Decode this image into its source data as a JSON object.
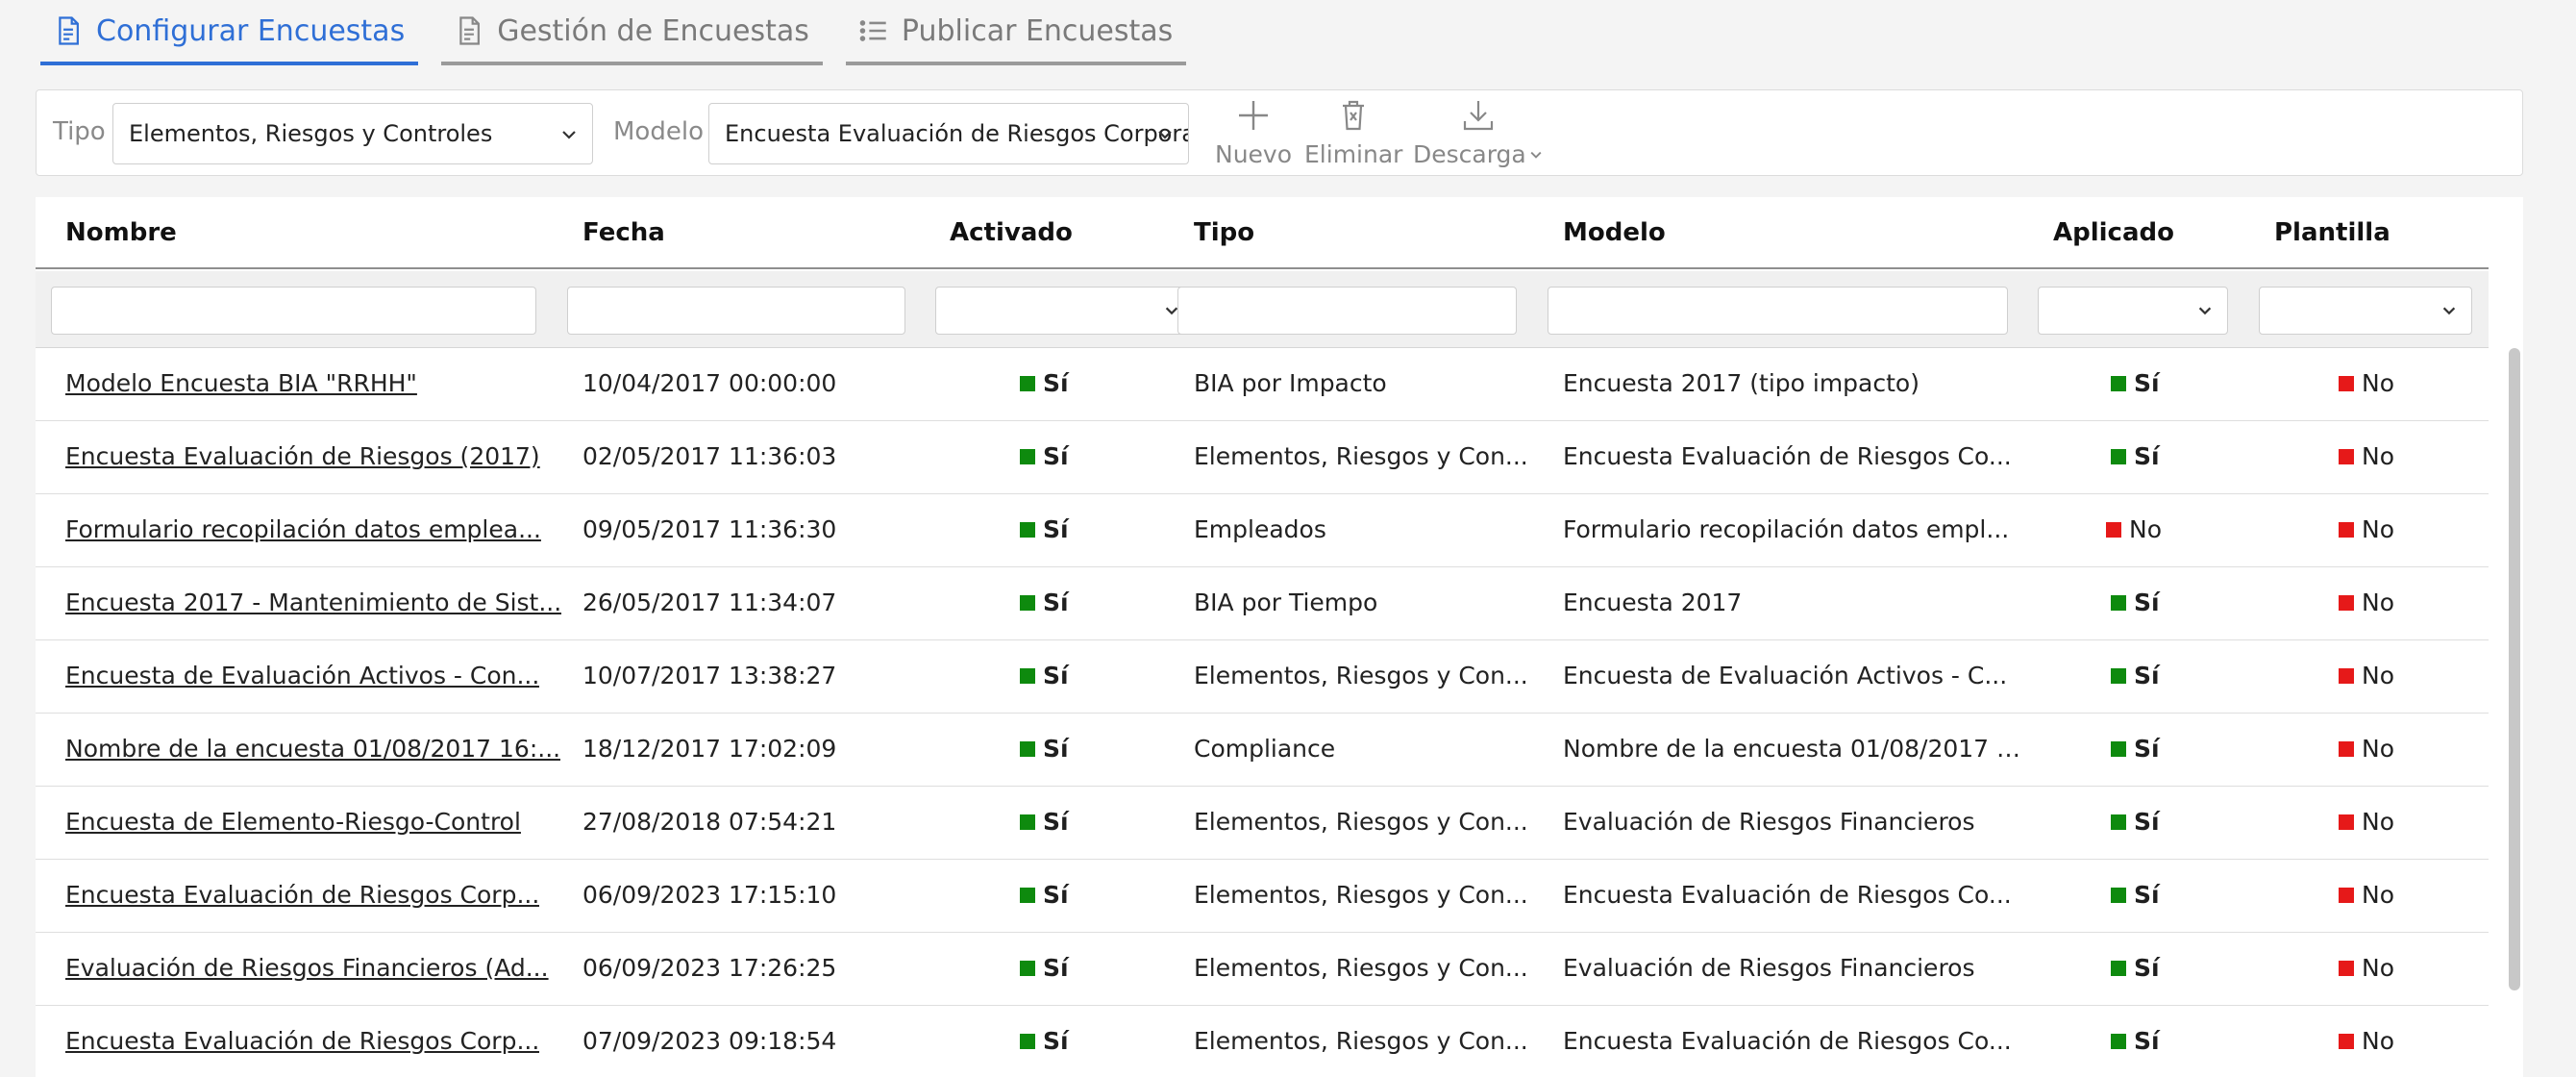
{
  "tabs": [
    {
      "label": "Configurar Encuestas",
      "active": true,
      "icon": "survey-config-icon"
    },
    {
      "label": "Gestión de Encuestas",
      "active": false,
      "icon": "survey-manage-icon"
    },
    {
      "label": "Publicar Encuestas",
      "active": false,
      "icon": "list-icon"
    }
  ],
  "toolbar": {
    "tipo_label": "Tipo",
    "tipo_value": "Elementos, Riesgos y Controles",
    "modelo_label": "Modelo",
    "modelo_value": "Encuesta Evaluación de Riesgos Corporativos",
    "nuevo_label": "Nuevo",
    "eliminar_label": "Eliminar",
    "descarga_label": "Descarga"
  },
  "columns": [
    "Nombre",
    "Fecha",
    "Activado",
    "Tipo",
    "Modelo",
    "Aplicado",
    "Plantilla"
  ],
  "rows": [
    {
      "nombre": "Modelo Encuesta BIA \"RRHH\"",
      "fecha": "10/04/2017 00:00:00",
      "activado": "Sí",
      "tipo": "BIA por Impacto",
      "modelo": "Encuesta 2017 (tipo impacto)",
      "aplicado": "Sí",
      "plantilla": "No"
    },
    {
      "nombre": "Encuesta Evaluación de Riesgos (2017)",
      "fecha": "02/05/2017 11:36:03",
      "activado": "Sí",
      "tipo": "Elementos, Riesgos y Con...",
      "modelo": "Encuesta Evaluación de Riesgos Co...",
      "aplicado": "Sí",
      "plantilla": "No"
    },
    {
      "nombre": "Formulario recopilación datos emplea...",
      "fecha": "09/05/2017 11:36:30",
      "activado": "Sí",
      "tipo": "Empleados",
      "modelo": "Formulario recopilación datos empl...",
      "aplicado": "No",
      "plantilla": "No"
    },
    {
      "nombre": "Encuesta 2017 - Mantenimiento de Sist...",
      "fecha": "26/05/2017 11:34:07",
      "activado": "Sí",
      "tipo": "BIA por Tiempo",
      "modelo": "Encuesta 2017",
      "aplicado": "Sí",
      "plantilla": "No"
    },
    {
      "nombre": "Encuesta de Evaluación Activos - Con...",
      "fecha": "10/07/2017 13:38:27",
      "activado": "Sí",
      "tipo": "Elementos, Riesgos y Con...",
      "modelo": "Encuesta de Evaluación Activos - C...",
      "aplicado": "Sí",
      "plantilla": "No"
    },
    {
      "nombre": "Nombre de la encuesta 01/08/2017 16:...",
      "fecha": "18/12/2017 17:02:09",
      "activado": "Sí",
      "tipo": "Compliance",
      "modelo": "Nombre de la encuesta 01/08/2017 1...",
      "aplicado": "Sí",
      "plantilla": "No"
    },
    {
      "nombre": "Encuesta de Elemento-Riesgo-Control",
      "fecha": "27/08/2018 07:54:21",
      "activado": "Sí",
      "tipo": "Elementos, Riesgos y Con...",
      "modelo": "Evaluación de Riesgos Financieros",
      "aplicado": "Sí",
      "plantilla": "No"
    },
    {
      "nombre": "Encuesta Evaluación de Riesgos Corp...",
      "fecha": "06/09/2023 17:15:10",
      "activado": "Sí",
      "tipo": "Elementos, Riesgos y Con...",
      "modelo": "Encuesta Evaluación de Riesgos Co...",
      "aplicado": "Sí",
      "plantilla": "No"
    },
    {
      "nombre": "Evaluación de Riesgos Financieros (Ad...",
      "fecha": "06/09/2023 17:26:25",
      "activado": "Sí",
      "tipo": "Elementos, Riesgos y Con...",
      "modelo": "Evaluación de Riesgos Financieros",
      "aplicado": "Sí",
      "plantilla": "No"
    },
    {
      "nombre": "Encuesta Evaluación de Riesgos Corp...",
      "fecha": "07/09/2023 09:18:54",
      "activado": "Sí",
      "tipo": "Elementos, Riesgos y Con...",
      "modelo": "Encuesta Evaluación de Riesgos Co...",
      "aplicado": "Sí",
      "plantilla": "No"
    }
  ],
  "colors": {
    "accent": "#2f6fd6",
    "yes": "#0e8a0e",
    "no": "#e61919"
  }
}
